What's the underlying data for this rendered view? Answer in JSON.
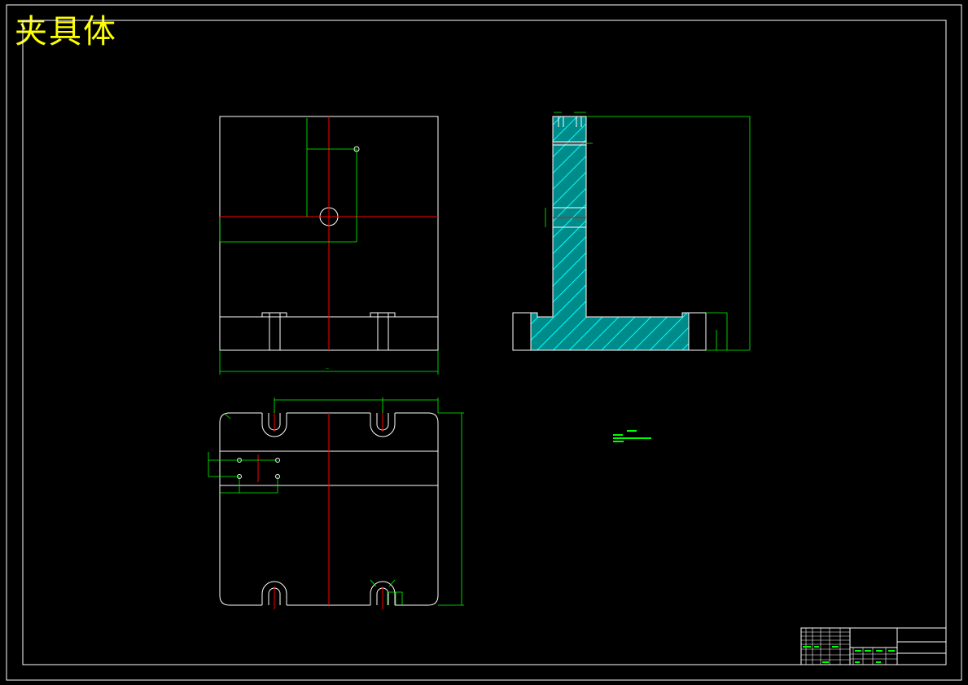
{
  "title": "夹具体",
  "colors": {
    "background": "#000000",
    "outline": "#ffffff",
    "dimension": "#00ff00",
    "centerline": "#ff0000",
    "section_hatch": "#00cccc",
    "title_text": "#ffff00"
  },
  "views": [
    "front-view",
    "side-section-view",
    "top-view"
  ],
  "title_block": {
    "present": true
  }
}
